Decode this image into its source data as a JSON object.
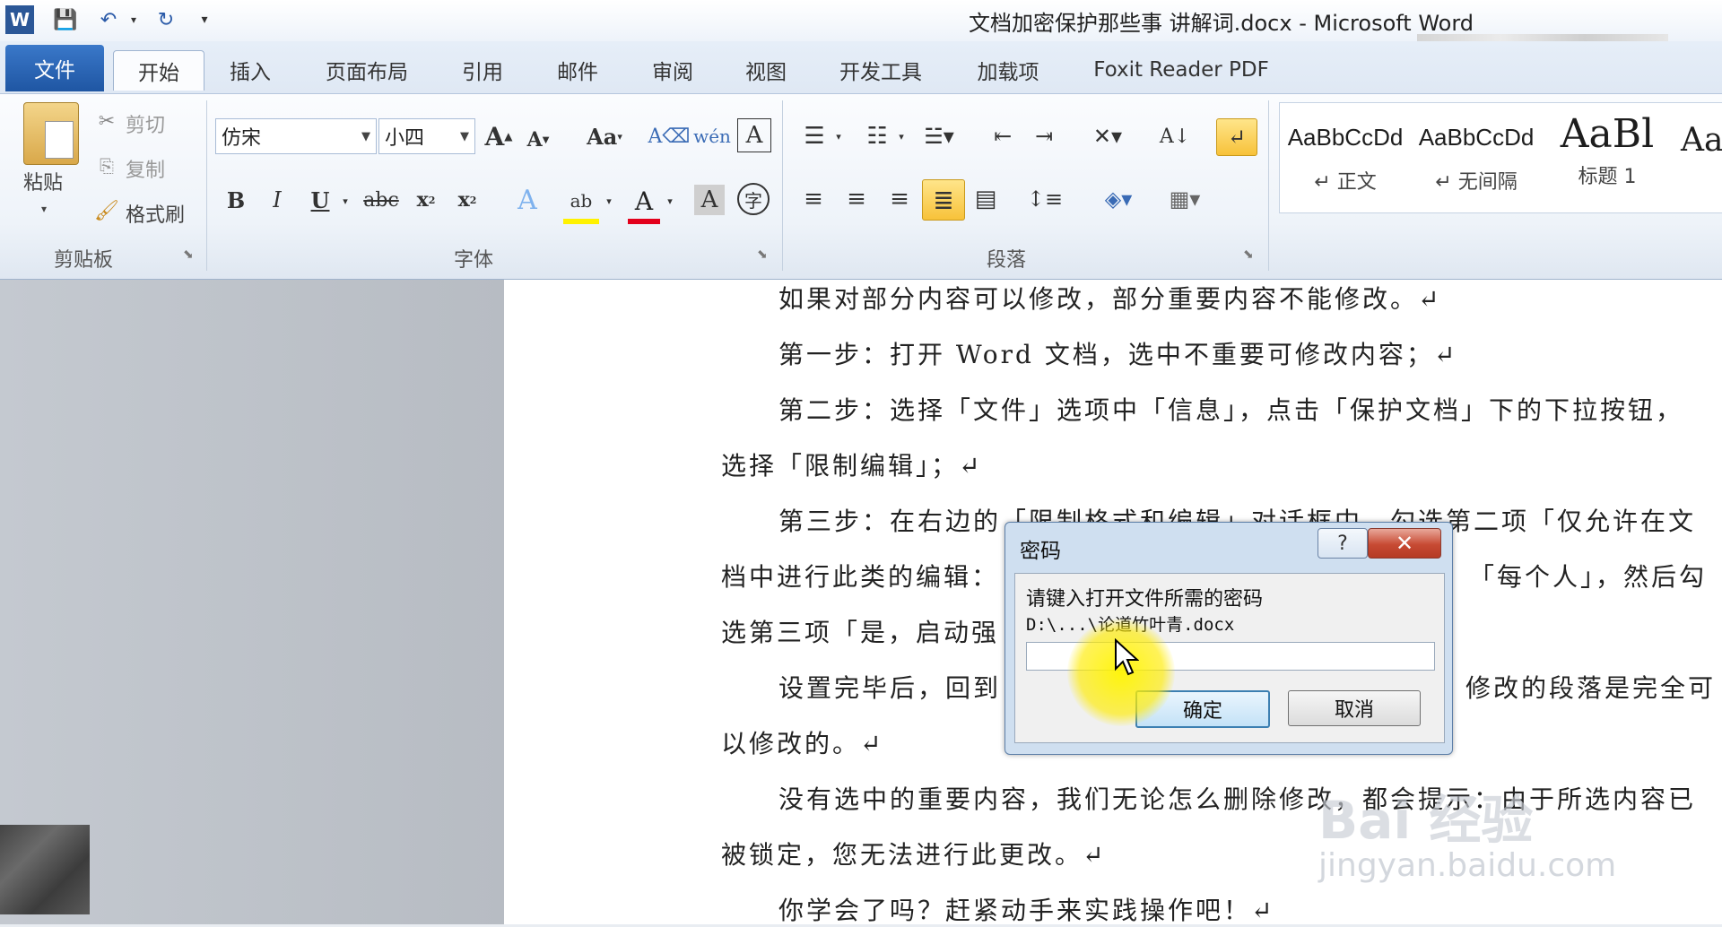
{
  "app": {
    "window_title": "文档加密保护那些事 讲解词.docx  -  Microsoft Word"
  },
  "tabs": [
    {
      "label": "文件"
    },
    {
      "label": "开始"
    },
    {
      "label": "插入"
    },
    {
      "label": "页面布局"
    },
    {
      "label": "引用"
    },
    {
      "label": "邮件"
    },
    {
      "label": "审阅"
    },
    {
      "label": "视图"
    },
    {
      "label": "开发工具"
    },
    {
      "label": "加载项"
    },
    {
      "label": "Foxit Reader PDF"
    }
  ],
  "ribbon": {
    "clipboard": {
      "paste_label": "粘贴",
      "cut_label": "剪切",
      "copy_label": "复制",
      "format_painter_label": "格式刷",
      "group_label": "剪贴板"
    },
    "font": {
      "font_name": "仿宋",
      "font_size": "小四",
      "group_label": "字体"
    },
    "paragraph": {
      "group_label": "段落"
    },
    "styles": [
      {
        "sample": "AaBbCcDd",
        "name": "↵ 正文"
      },
      {
        "sample": "AaBbCcDd",
        "name": "↵ 无间隔"
      },
      {
        "sample": "AaBl",
        "name": "标题 1"
      }
    ]
  },
  "document": {
    "paragraphs": [
      "如果对部分内容可以修改，部分重要内容不能修改。↵",
      "第一步：打开 Word 文档，选中不重要可修改内容；↵",
      "第二步：选择「文件」选项中「信息」，点击「保护文档」下的下拉按钮，",
      "选择「限制编辑」；↵",
      "第三步：在右边的「限制格式和编辑」对话框中，勾选第二项「仅允许在文",
      "档中进行此类的编辑：",
      "「每个人」，然后勾",
      "选第三项「是，启动强",
      "设置完毕后，回到",
      "修改的段落是完全可",
      "以修改的。↵",
      "没有选中的重要内容，我们无论怎么删除修改，都会提示：由于所选内容已",
      "被锁定，您无法进行此更改。↵",
      "你学会了吗？赶紧动手来实践操作吧！↵"
    ]
  },
  "dialog": {
    "title": "密码",
    "help_label": "?",
    "close_label": "✕",
    "message": "请键入打开文件所需的密码",
    "path": "D:\\...\\论道竹叶青.docx",
    "password_value": "",
    "ok_label": "确定",
    "cancel_label": "取消"
  },
  "watermark": {
    "text": "Bai 经验",
    "url": "jingyan.baidu.com"
  }
}
